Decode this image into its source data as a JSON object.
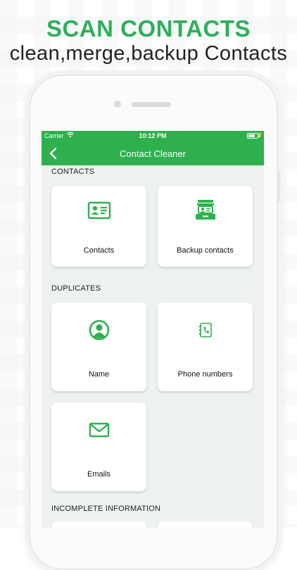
{
  "promo": {
    "headline": "SCAN CONTACTS",
    "subline": "clean,merge,backup Contacts"
  },
  "status_bar": {
    "carrier": "Carrier",
    "time": "10:12 PM"
  },
  "nav": {
    "title": "Contact Cleaner"
  },
  "sections": {
    "contacts": "CONTACTS",
    "duplicates": "DUPLICATES",
    "incomplete": "INCOMPLETE INFORMATION"
  },
  "cards": {
    "contacts": "Contacts",
    "backup": "Backup contacts",
    "name": "Name",
    "phone": "Phone numbers",
    "emails": "Emails"
  },
  "colors": {
    "accent": "#2eb04f",
    "screen_bg": "#edf2ee"
  }
}
